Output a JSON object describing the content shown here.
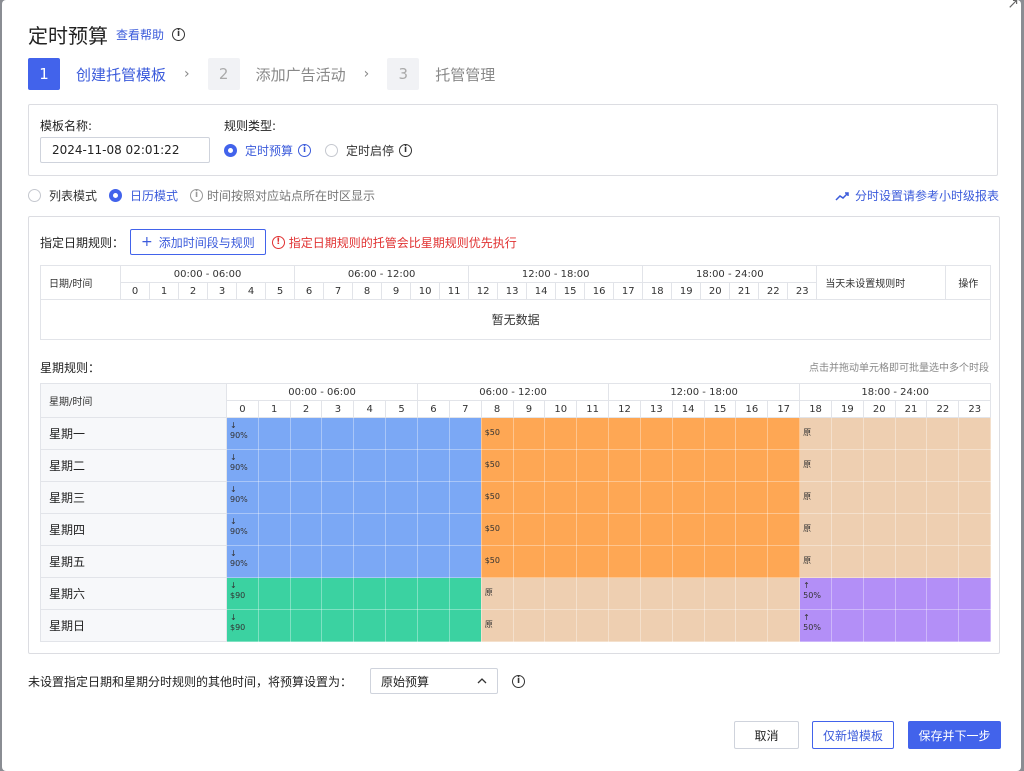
{
  "title": "定时预算",
  "help_link": "查看帮助",
  "steps": [
    {
      "num": "1",
      "label": "创建托管模板"
    },
    {
      "num": "2",
      "label": "添加广告活动"
    },
    {
      "num": "3",
      "label": "托管管理"
    }
  ],
  "form": {
    "template_name_label": "模板名称:",
    "template_name_value": "2024-11-08 02:01:22",
    "rule_type_label": "规则类型:",
    "rule_type_options": [
      "定时预算",
      "定时启停"
    ],
    "rule_type_selected": "定时预算"
  },
  "mode": {
    "options": [
      "列表模式",
      "日历模式"
    ],
    "selected": "日历模式",
    "note": "时间按照对应站点所在时区显示"
  },
  "report_link": "分时设置请参考小时级报表",
  "date_rules": {
    "label": "指定日期规则：",
    "add_button": "添加时间段与规则",
    "warning": "指定日期规则的托管会比星期规则优先执行",
    "headers": {
      "date_time": "日期/时间",
      "groups": [
        "00:00 - 06:00",
        "06:00 - 12:00",
        "12:00 - 18:00",
        "18:00 - 24:00"
      ],
      "hours": [
        "0",
        "1",
        "2",
        "3",
        "4",
        "5",
        "6",
        "7",
        "8",
        "9",
        "10",
        "11",
        "12",
        "13",
        "14",
        "15",
        "16",
        "17",
        "18",
        "19",
        "20",
        "21",
        "22",
        "23"
      ],
      "unset": "当天未设置规则时",
      "action": "操作"
    },
    "empty": "暂无数据"
  },
  "week_rules": {
    "label": "星期规则：",
    "hint": "点击并拖动单元格即可批量选中多个时段",
    "header_label": "星期/时间",
    "groups": [
      "00:00 - 06:00",
      "06:00 - 12:00",
      "12:00 - 18:00",
      "18:00 - 24:00"
    ],
    "hours": [
      "0",
      "1",
      "2",
      "3",
      "4",
      "5",
      "6",
      "7",
      "8",
      "9",
      "10",
      "11",
      "12",
      "13",
      "14",
      "15",
      "16",
      "17",
      "18",
      "19",
      "20",
      "21",
      "22",
      "23"
    ],
    "colors": {
      "decrease_pct": "#7ba8f5",
      "fixed_50": "#fea754",
      "original": "#eecfb1",
      "fixed_90": "#3bd2a1",
      "increase_pct": "#b38ff7"
    },
    "days": [
      {
        "name": "星期一",
        "segments": [
          {
            "start": 0,
            "end": 8,
            "color": "decrease_pct",
            "arrow": "↓",
            "value": "90%"
          },
          {
            "start": 8,
            "end": 18,
            "color": "fixed_50",
            "arrow": "",
            "value": "$50"
          },
          {
            "start": 18,
            "end": 24,
            "color": "original",
            "arrow": "",
            "value": "原"
          }
        ]
      },
      {
        "name": "星期二",
        "segments": [
          {
            "start": 0,
            "end": 8,
            "color": "decrease_pct",
            "arrow": "↓",
            "value": "90%"
          },
          {
            "start": 8,
            "end": 18,
            "color": "fixed_50",
            "arrow": "",
            "value": "$50"
          },
          {
            "start": 18,
            "end": 24,
            "color": "original",
            "arrow": "",
            "value": "原"
          }
        ]
      },
      {
        "name": "星期三",
        "segments": [
          {
            "start": 0,
            "end": 8,
            "color": "decrease_pct",
            "arrow": "↓",
            "value": "90%"
          },
          {
            "start": 8,
            "end": 18,
            "color": "fixed_50",
            "arrow": "",
            "value": "$50"
          },
          {
            "start": 18,
            "end": 24,
            "color": "original",
            "arrow": "",
            "value": "原"
          }
        ]
      },
      {
        "name": "星期四",
        "segments": [
          {
            "start": 0,
            "end": 8,
            "color": "decrease_pct",
            "arrow": "↓",
            "value": "90%"
          },
          {
            "start": 8,
            "end": 18,
            "color": "fixed_50",
            "arrow": "",
            "value": "$50"
          },
          {
            "start": 18,
            "end": 24,
            "color": "original",
            "arrow": "",
            "value": "原"
          }
        ]
      },
      {
        "name": "星期五",
        "segments": [
          {
            "start": 0,
            "end": 8,
            "color": "decrease_pct",
            "arrow": "↓",
            "value": "90%"
          },
          {
            "start": 8,
            "end": 18,
            "color": "fixed_50",
            "arrow": "",
            "value": "$50"
          },
          {
            "start": 18,
            "end": 24,
            "color": "original",
            "arrow": "",
            "value": "原"
          }
        ]
      },
      {
        "name": "星期六",
        "segments": [
          {
            "start": 0,
            "end": 8,
            "color": "fixed_90",
            "arrow": "↓",
            "value": "$90"
          },
          {
            "start": 8,
            "end": 18,
            "color": "original",
            "arrow": "",
            "value": "原"
          },
          {
            "start": 18,
            "end": 24,
            "color": "increase_pct",
            "arrow": "↑",
            "value": "50%"
          }
        ]
      },
      {
        "name": "星期日",
        "segments": [
          {
            "start": 0,
            "end": 8,
            "color": "fixed_90",
            "arrow": "↓",
            "value": "$90"
          },
          {
            "start": 8,
            "end": 18,
            "color": "original",
            "arrow": "",
            "value": "原"
          },
          {
            "start": 18,
            "end": 24,
            "color": "increase_pct",
            "arrow": "↑",
            "value": "50%"
          }
        ]
      }
    ]
  },
  "other_time": {
    "label": "未设置指定日期和星期分时规则的其他时间，将预算设置为：",
    "select_value": "原始预算"
  },
  "buttons": {
    "cancel": "取消",
    "new_template": "仅新增模板",
    "save_next": "保存并下一步"
  }
}
